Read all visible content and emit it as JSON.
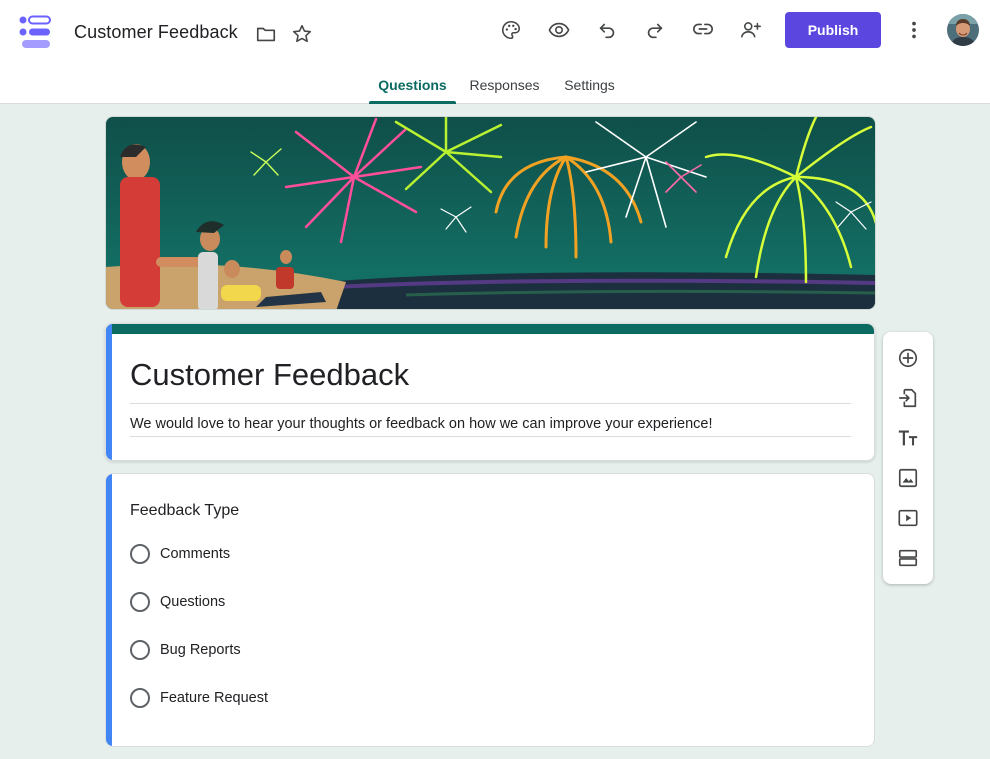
{
  "app": {
    "title": "Customer Feedback",
    "icons": [
      "app-logo",
      "folder-icon",
      "star-icon"
    ]
  },
  "toolbar": {
    "icons": [
      "palette-icon",
      "preview-icon",
      "undo-icon",
      "redo-icon",
      "link-icon",
      "add-collaborator-icon"
    ],
    "publish_label": "Publish",
    "more_icon": "more-vert-icon",
    "accent": "#5b47e0"
  },
  "tabs": [
    {
      "label": "Questions",
      "active": true
    },
    {
      "label": "Responses",
      "active": false
    },
    {
      "label": "Settings",
      "active": false
    }
  ],
  "form": {
    "title": "Customer Feedback",
    "description": "We would love to hear your thoughts or feedback on how we can improve your experience!",
    "theme_color": "#0b6b61"
  },
  "question": {
    "title": "Feedback Type",
    "type": "multiple-choice",
    "options": [
      "Comments",
      "Questions",
      "Bug Reports",
      "Feature Request"
    ]
  },
  "side_toolbar": {
    "icons": [
      "add-question-icon",
      "import-questions-icon",
      "add-title-icon",
      "add-image-icon",
      "add-video-icon",
      "add-section-icon"
    ]
  }
}
